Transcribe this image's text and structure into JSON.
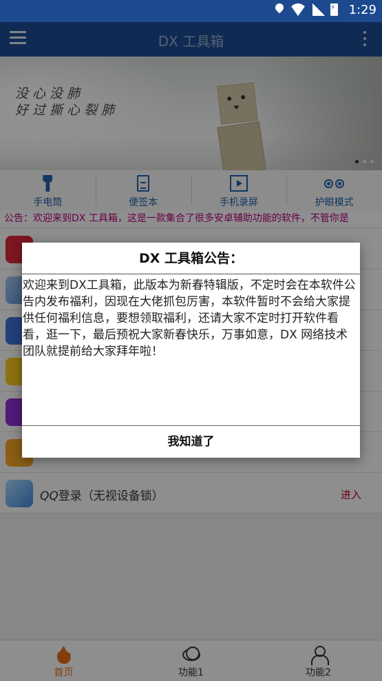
{
  "status_bar": {
    "time": "1:29",
    "icons": [
      "location-icon",
      "wifi-icon",
      "signal-icon",
      "battery-charging-icon"
    ]
  },
  "toolbar": {
    "title": "DX 工具箱",
    "menu_icon": "hamburger-menu-icon",
    "more_icon": "more-vertical-icon"
  },
  "banner": {
    "poem_line1": "没心没肺",
    "poem_line2": "好过撕心裂肺",
    "pages": 3,
    "current_page": 1
  },
  "tools": [
    {
      "label": "手电筒",
      "icon": "flashlight-icon"
    },
    {
      "label": "便签本",
      "icon": "notepad-icon"
    },
    {
      "label": "手机录屏",
      "icon": "screen-record-icon"
    },
    {
      "label": "护眼模式",
      "icon": "eye-protection-icon"
    }
  ],
  "notice": {
    "text": "公告：欢迎来到DX 工具箱，这是一款集合了很多安卓辅助功能的软件，不管你是"
  },
  "list": {
    "last_row": {
      "name_prefix": "QQ",
      "name_suffix": "登录（无视设备锁）",
      "action": "进入"
    }
  },
  "dialog": {
    "title": "DX 工具箱公告：",
    "body": "欢迎来到DX工具箱，此版本为新春特辑版，不定时会在本软件公告内发布福利，因现在大佬抓包厉害，本软件暂时不会给大家提供任何福利信息，要想领取福利，还请大家不定时打开软件看看，逛一下，最后预祝大家新春快乐，万事如意，DX 网络技术团队就提前给大家拜年啦！",
    "confirm": "我知道了"
  },
  "bottom_nav": [
    {
      "label": "首页",
      "icon": "fire-icon",
      "active": true
    },
    {
      "label": "功能1",
      "icon": "planet-icon",
      "active": false
    },
    {
      "label": "功能2",
      "icon": "user-icon",
      "active": false
    }
  ],
  "colors": {
    "primary": "#1d4a8f",
    "accent": "#e06a14",
    "notice": "#b0007c",
    "action": "#c2001a"
  }
}
